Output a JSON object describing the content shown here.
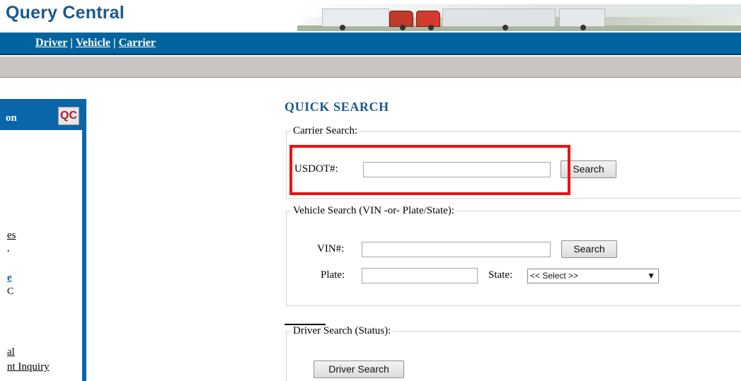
{
  "header": {
    "app_title": "Query Central"
  },
  "nav": {
    "links": [
      {
        "label": "Driver"
      },
      {
        "label": "Vehicle"
      },
      {
        "label": "Carrier"
      }
    ],
    "separator": "|"
  },
  "left_panel": {
    "title_fragment": "on",
    "badge": "QC",
    "links": [
      {
        "label": "es"
      },
      {
        "label": "e"
      },
      {
        "label": "al"
      },
      {
        "label": "nt Inquiry"
      }
    ],
    "fragments": [
      ",",
      "C"
    ]
  },
  "quick_search": {
    "title": "QUICK SEARCH",
    "carrier": {
      "legend": "Carrier Search:",
      "usdot_label": "USDOT#:",
      "usdot_value": "",
      "search_button": "Search"
    },
    "vehicle": {
      "legend": "Vehicle Search (VIN -or- Plate/State):",
      "vin_label": "VIN#:",
      "vin_value": "",
      "search_button": "Search",
      "plate_label": "Plate:",
      "plate_value": "",
      "state_label": "State:",
      "state_selected": "<< Select >>"
    },
    "driver": {
      "legend": "Driver Search (Status):",
      "search_button": "Driver Search"
    }
  },
  "colors": {
    "nav_blue": "#00649e",
    "title_blue": "#1a5a8c",
    "highlight_red": "#ee1111",
    "badge_red": "#b01c2e"
  }
}
